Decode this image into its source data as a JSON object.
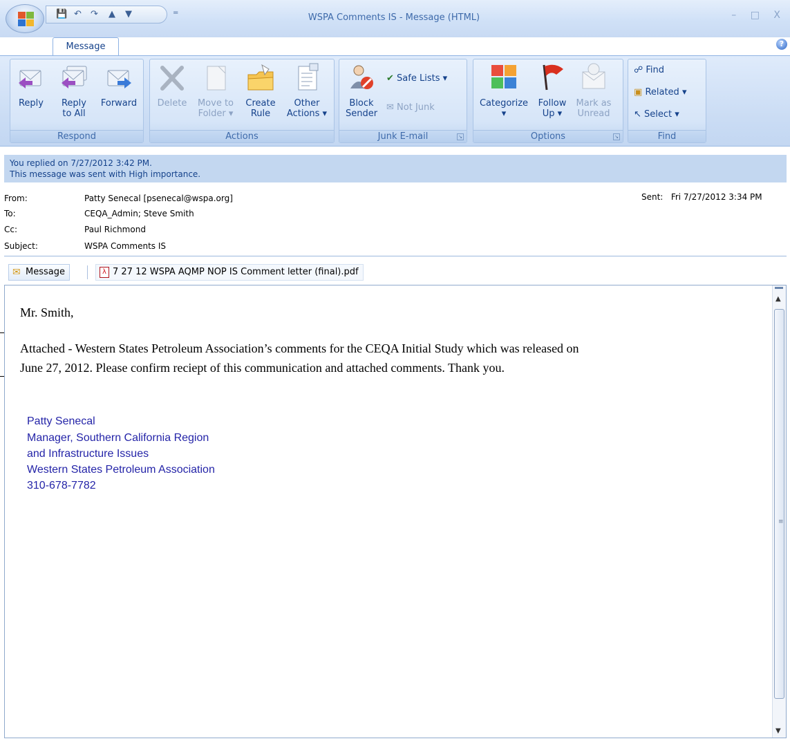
{
  "window": {
    "title": "WSPA Comments IS  - Message (HTML)",
    "controls": "– □ X",
    "tab_label": "Message",
    "help": "?"
  },
  "quick_access": {
    "more": "="
  },
  "ribbon": {
    "respond": {
      "label": "Respond",
      "reply": "Reply",
      "reply_all_1": "Reply",
      "reply_all_2": "to All",
      "forward": "Forward"
    },
    "actions": {
      "label": "Actions",
      "delete": "Delete",
      "move_1": "Move to",
      "move_2": "Folder ▾",
      "create_1": "Create",
      "create_2": "Rule",
      "other_1": "Other",
      "other_2": "Actions ▾"
    },
    "junk": {
      "label": "Junk E-mail",
      "block_1": "Block",
      "block_2": "Sender",
      "safe_lists": "Safe Lists ▾",
      "not_junk": "Not Junk"
    },
    "options": {
      "label": "Options",
      "categorize_1": "Categorize",
      "categorize_2": "▾",
      "follow_1": "Follow",
      "follow_2": "Up ▾",
      "mark_1": "Mark as",
      "mark_2": "Unread"
    },
    "find": {
      "label": "Find",
      "find": "Find",
      "related": "Related ▾",
      "select": "Select ▾"
    }
  },
  "info": {
    "line1": "You replied on 7/27/2012 3:42 PM.",
    "line2": "This message was sent with High importance."
  },
  "header": {
    "from_label": "From:",
    "from_value": "Patty Senecal [psenecal@wspa.org]",
    "to_label": "To:",
    "to_value": "CEQA_Admin; Steve Smith",
    "cc_label": "Cc:",
    "cc_value": "Paul Richmond",
    "subject_label": "Subject:",
    "subject_value": "WSPA Comments IS",
    "sent_label": "Sent:",
    "sent_value": "Fri 7/27/2012 3:34 PM"
  },
  "attachments": {
    "message_tab": "Message",
    "file_name": "7 27 12 WSPA AQMP NOP IS Comment letter (final).pdf"
  },
  "body": {
    "greeting": "Mr. Smith,",
    "para_line1": "Attached - Western States Petroleum Association’s comments for the CEQA Initial Study which was released on",
    "para_line2": "June 27, 2012.  Please confirm reciept of this communication and attached comments.  Thank you.",
    "sig_name": "Patty Senecal",
    "sig_title1": "Manager, Southern California Region",
    "sig_title2": "and Infrastructure Issues",
    "sig_org": "Western States Petroleum Association",
    "sig_phone": "310-678-7782"
  }
}
